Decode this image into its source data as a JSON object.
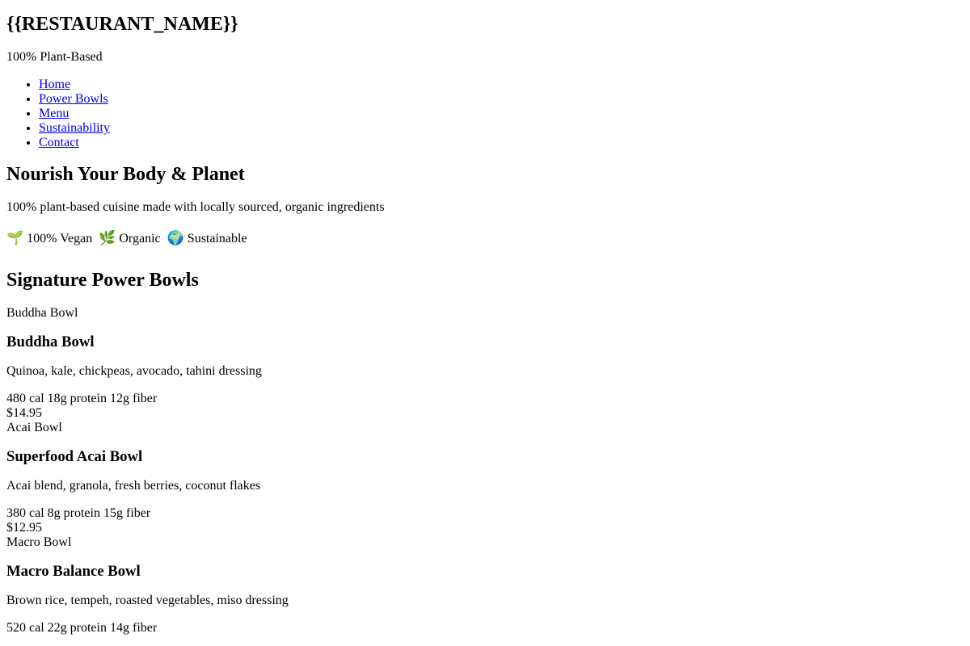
{
  "header": {
    "restaurant_name": "{{RESTAURANT_NAME}}",
    "tagline": "100% Plant-Based"
  },
  "nav": {
    "items": [
      {
        "label": "Home"
      },
      {
        "label": "Power Bowls"
      },
      {
        "label": "Menu"
      },
      {
        "label": "Sustainability"
      },
      {
        "label": "Contact"
      }
    ]
  },
  "hero": {
    "title": "Nourish Your Body & Planet",
    "subtitle": "100% plant-based cuisine made with locally sourced, organic ingredients",
    "badges": [
      {
        "icon": "seedling-icon",
        "glyph": "🌱",
        "label": "100% Vegan"
      },
      {
        "icon": "herb-icon",
        "glyph": "🌿",
        "label": "Organic"
      },
      {
        "icon": "globe-icon",
        "glyph": "🌍",
        "label": "Sustainable"
      }
    ]
  },
  "bowls_section": {
    "title": "Signature Power Bowls",
    "bowls": [
      {
        "image_alt": "Buddha Bowl",
        "name": "Buddha Bowl",
        "description": "Quinoa, kale, chickpeas, avocado, tahini dressing",
        "calories": "480 cal",
        "protein": "18g protein",
        "fiber": "12g fiber",
        "price": "$14.95"
      },
      {
        "image_alt": "Acai Bowl",
        "name": "Superfood Acai Bowl",
        "description": "Acai blend, granola, fresh berries, coconut flakes",
        "calories": "380 cal",
        "protein": "8g protein",
        "fiber": "15g fiber",
        "price": "$12.95"
      },
      {
        "image_alt": "Macro Bowl",
        "name": "Macro Balance Bowl",
        "description": "Brown rice, tempeh, roasted vegetables, miso dressing",
        "calories": "520 cal",
        "protein": "22g protein",
        "fiber": "14g fiber",
        "price": ""
      }
    ]
  }
}
